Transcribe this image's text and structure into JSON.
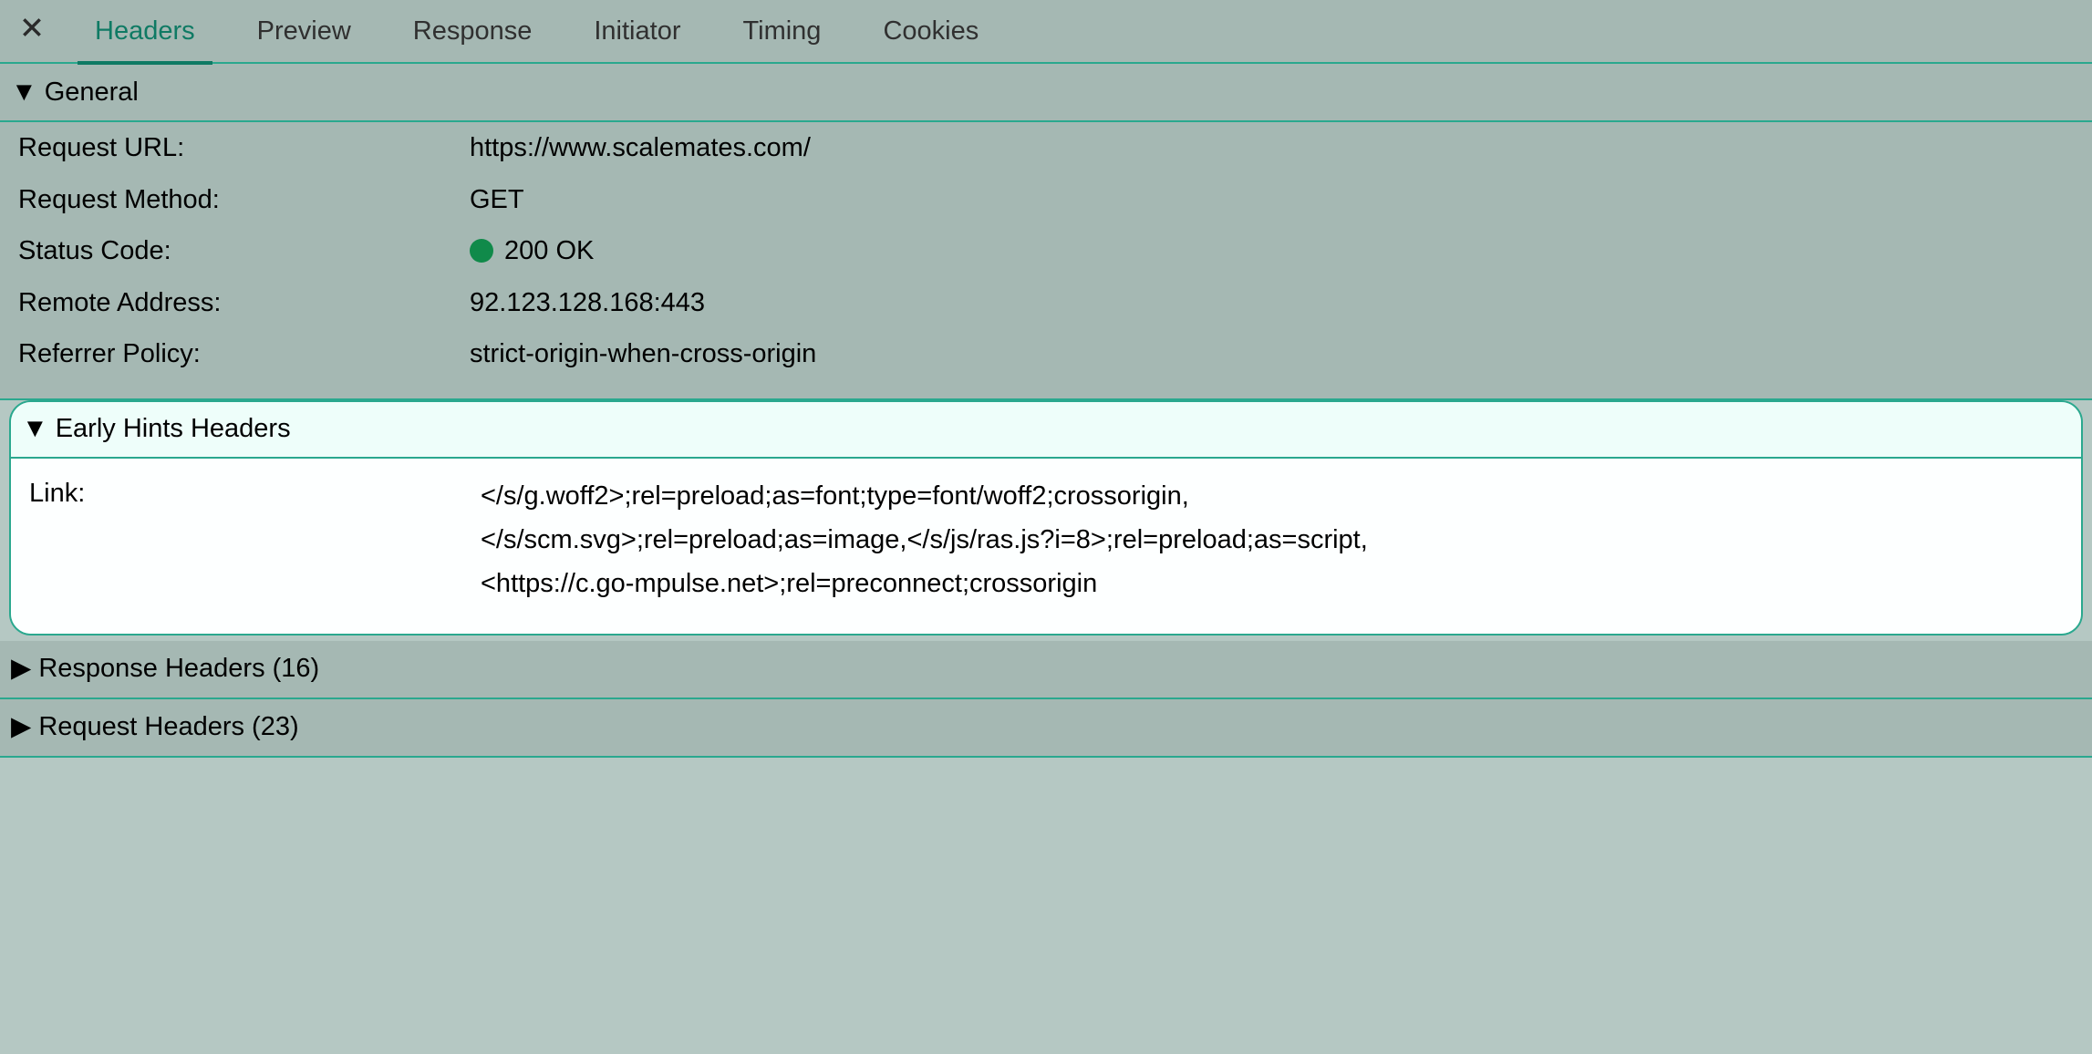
{
  "tabs": {
    "headers": "Headers",
    "preview": "Preview",
    "response": "Response",
    "initiator": "Initiator",
    "timing": "Timing",
    "cookies": "Cookies"
  },
  "sections": {
    "general": {
      "title": "General",
      "rows": {
        "request_url": {
          "key": "Request URL:",
          "value": "https://www.scalemates.com/"
        },
        "request_method": {
          "key": "Request Method:",
          "value": "GET"
        },
        "status_code": {
          "key": "Status Code:",
          "value": "200 OK"
        },
        "remote_address": {
          "key": "Remote Address:",
          "value": "92.123.128.168:443"
        },
        "referrer_policy": {
          "key": "Referrer Policy:",
          "value": "strict-origin-when-cross-origin"
        }
      }
    },
    "early_hints": {
      "title": "Early Hints Headers",
      "rows": {
        "link": {
          "key": "Link:",
          "value": "</s/g.woff2>;rel=preload;as=font;type=font/woff2;crossorigin,\n</s/scm.svg>;rel=preload;as=image,</s/js/ras.js?i=8>;rel=preload;as=script,\n<https://c.go-mpulse.net>;rel=preconnect;crossorigin"
        }
      }
    },
    "response_headers": {
      "title": "Response Headers (16)"
    },
    "request_headers": {
      "title": "Request Headers (23)"
    }
  }
}
